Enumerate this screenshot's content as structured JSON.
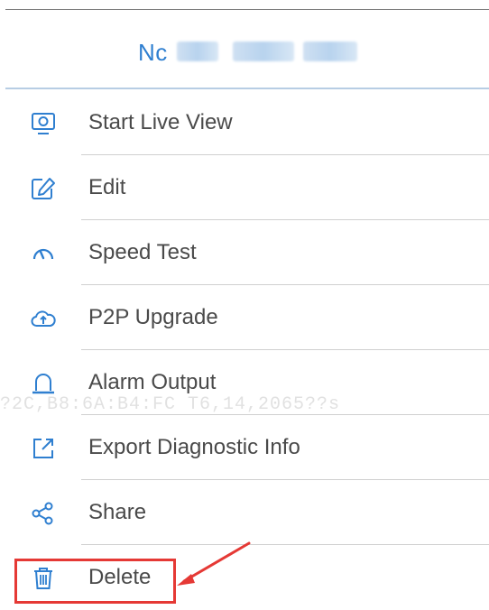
{
  "header": {
    "title_visible": "Nc"
  },
  "menu": {
    "items": [
      {
        "label": "Start Live View",
        "icon": "monitor-icon"
      },
      {
        "label": "Edit",
        "icon": "edit-icon"
      },
      {
        "label": "Speed Test",
        "icon": "speedometer-icon"
      },
      {
        "label": "P2P Upgrade",
        "icon": "cloud-upload-icon"
      },
      {
        "label": "Alarm Output",
        "icon": "alarm-light-icon"
      },
      {
        "label": "Export Diagnostic Info",
        "icon": "export-icon"
      },
      {
        "label": "Share",
        "icon": "share-icon"
      },
      {
        "label": "Delete",
        "icon": "trash-icon"
      }
    ]
  },
  "watermark": "?2C,B8:6A:B4:FC T6,14,2065??s",
  "colors": {
    "accent": "#2f7fd0",
    "icon": "#2f7fd0",
    "text": "#4a4a4a",
    "highlight": "#e53935"
  }
}
